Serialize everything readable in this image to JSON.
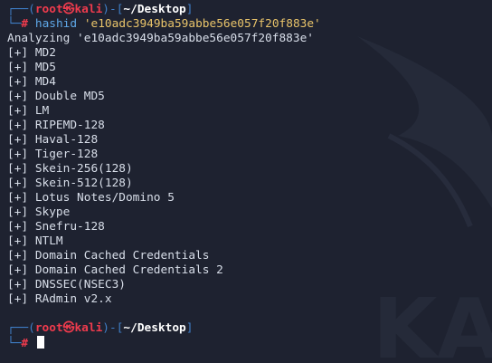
{
  "prompt_1": {
    "frame_top": "┌──(",
    "user": "root",
    "at_symbol": "㉿",
    "host": "kali",
    "frame_mid": ")-[",
    "path": "~/Desktop",
    "frame_end": "]",
    "frame_bottom": "└─",
    "sign": "#",
    "command": "hashid",
    "argument": "'e10adc3949ba59abbe56e057f20f883e'"
  },
  "output": {
    "analyzing": "Analyzing 'e10adc3949ba59abbe56e057f20f883e'",
    "results": [
      "[+] MD2",
      "[+] MD5",
      "[+] MD4",
      "[+] Double MD5",
      "[+] LM",
      "[+] RIPEMD-128",
      "[+] Haval-128",
      "[+] Tiger-128",
      "[+] Skein-256(128)",
      "[+] Skein-512(128)",
      "[+] Lotus Notes/Domino 5",
      "[+] Skype",
      "[+] Snefru-128",
      "[+] NTLM",
      "[+] Domain Cached Credentials",
      "[+] Domain Cached Credentials 2",
      "[+] DNSSEC(NSEC3)",
      "[+] RAdmin v2.x"
    ]
  },
  "prompt_2": {
    "frame_top": "┌──(",
    "user": "root",
    "at_symbol": "㉿",
    "host": "kali",
    "frame_mid": ")-[",
    "path": "~/Desktop",
    "frame_end": "]",
    "frame_bottom": "└─",
    "sign": "#"
  },
  "colors": {
    "background": "#1e2230",
    "frame": "#3f7fc7",
    "root": "#ef3b4d",
    "command": "#5fa8e8",
    "argument": "#e9c46a"
  },
  "wallpaper": {
    "icon": "kali-dragon-logo",
    "text": "KALI"
  }
}
